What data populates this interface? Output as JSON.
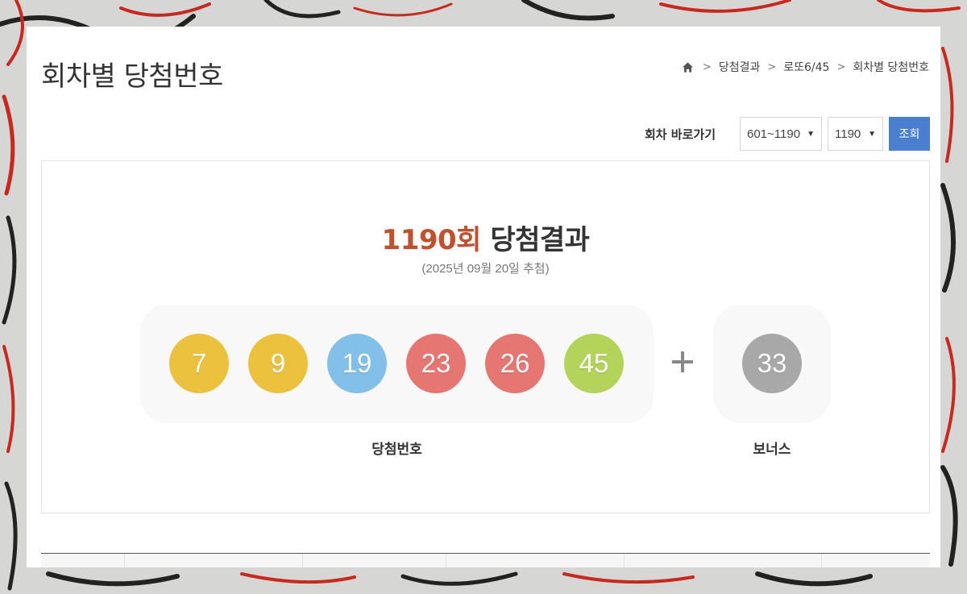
{
  "page": {
    "title": "회차별 당첨번호"
  },
  "breadcrumb": {
    "items": [
      "당첨결과",
      "로또6/45",
      "회차별 당첨번호"
    ]
  },
  "round_nav": {
    "label": "회차 바로가기",
    "range_select": "601~1190",
    "round_select": "1190",
    "query_button": "조회"
  },
  "result": {
    "round_number": "1190회",
    "heading_suffix": "당첨결과",
    "draw_date": "(2025년 09월 20일 추첨)",
    "winning_numbers": [
      {
        "value": "7",
        "color": "#ebc13d"
      },
      {
        "value": "9",
        "color": "#ebc13d"
      },
      {
        "value": "19",
        "color": "#82c0ea"
      },
      {
        "value": "23",
        "color": "#e57672"
      },
      {
        "value": "26",
        "color": "#e57672"
      },
      {
        "value": "45",
        "color": "#b3d35a"
      }
    ],
    "bonus_number": {
      "value": "33",
      "color": "#a8a8a8"
    },
    "numbers_caption": "당첨번호",
    "bonus_caption": "보너스"
  },
  "colors": {
    "accent_blue": "#4a7fd0",
    "round_highlight": "#c1502e"
  }
}
